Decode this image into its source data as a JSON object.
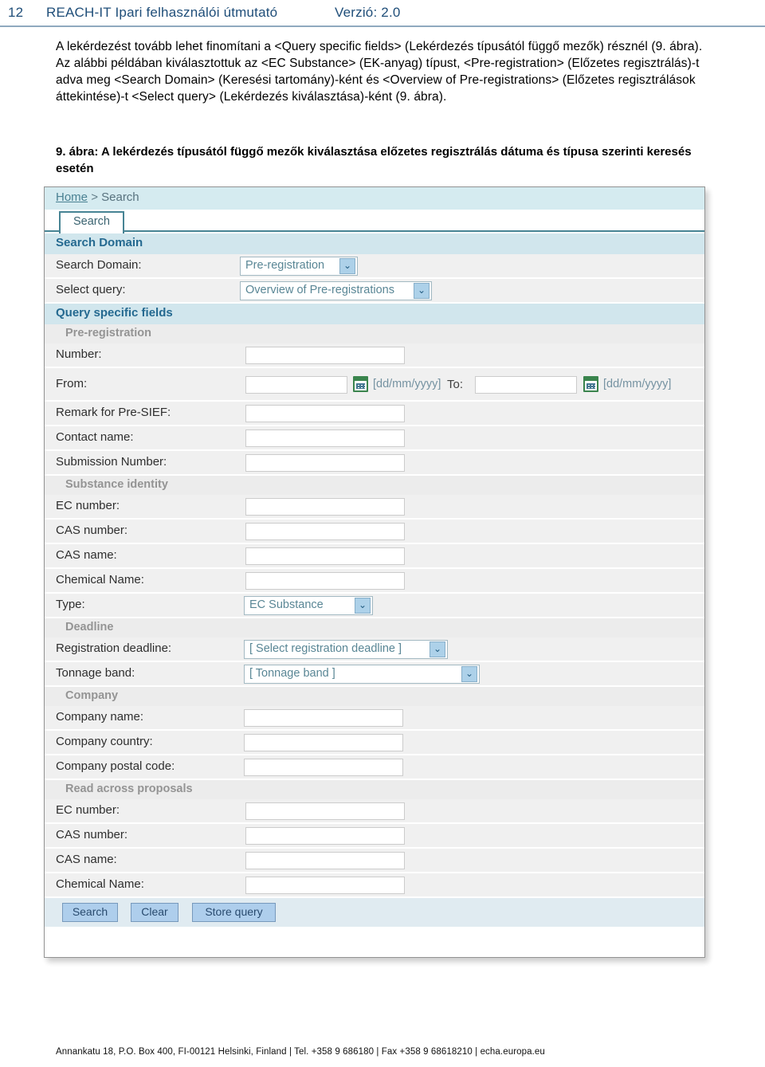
{
  "header": {
    "page_number": "12",
    "title": "REACH-IT Ipari felhasználói útmutató",
    "version": "Verzió: 2.0"
  },
  "body": {
    "paragraph": "A lekérdezést tovább lehet finomítani a <Query specific fields> (Lekérdezés típusától függő mezők) résznél (9. ábra). Az alábbi példában kiválasztottuk az <EC Substance> (EK-anyag) típust, <Pre-registration> (Előzetes regisztrálás)-t adva meg <Search Domain> (Keresési tartomány)-ként és <Overview of Pre-registrations> (Előzetes regisztrálások áttekintése)-t <Select query> (Lekérdezés kiválasztása)-ként (9. ábra).",
    "figure_caption": "9. ábra: A lekérdezés típusától függő mezők kiválasztása előzetes regisztrálás dátuma és típusa szerinti keresés esetén"
  },
  "screenshot": {
    "breadcrumb": {
      "home": "Home",
      "separator": ">",
      "current": "Search"
    },
    "tab": {
      "label": "Search"
    },
    "search_domain_band": "Search Domain",
    "search_domain_row": {
      "label": "Search Domain:",
      "value": "Pre-registration"
    },
    "select_query_row": {
      "label": "Select query:",
      "value": "Overview of Pre-registrations"
    },
    "query_specific_band": "Query specific fields",
    "groups": {
      "pre_registration": "Pre-registration",
      "substance_identity": "Substance identity",
      "deadline": "Deadline",
      "company": "Company",
      "read_across": "Read across proposals"
    },
    "fields": {
      "number": "Number:",
      "from": "From:",
      "to": "To:",
      "date_hint": "[dd/mm/yyyy]",
      "remark_presief": "Remark for Pre-SIEF:",
      "contact_name": "Contact name:",
      "submission_number": "Submission Number:",
      "ec_number": "EC number:",
      "cas_number": "CAS number:",
      "cas_name": "CAS name:",
      "chemical_name": "Chemical Name:",
      "type": "Type:",
      "registration_deadline": "Registration deadline:",
      "tonnage_band": "Tonnage band:",
      "company_name": "Company name:",
      "company_country": "Company country:",
      "company_postal_code": "Company postal code:"
    },
    "values": {
      "type": "EC Substance",
      "registration_deadline": "[ Select registration deadline ]",
      "tonnage_band": "[ Tonnage band ]"
    },
    "buttons": {
      "search": "Search",
      "clear": "Clear",
      "store_query": "Store query"
    },
    "dropdown_arrow": "⌄",
    "colors": {
      "breadcrumb_bg": "#d3eaf0",
      "band_bg": "#cfe5ec",
      "band_text": "#17608a",
      "row_bg": "#f0f0f0",
      "subband_text": "#8e8e8e",
      "button_bg": "#a9cbeb",
      "tab_border": "#3c7d8e",
      "calendar_green": "#2e7d42"
    }
  },
  "footer": {
    "text": "Annankatu 18, P.O. Box 400, FI-00121 Helsinki, Finland | Tel. +358 9 686180 | Fax +358 9 68618210 | echa.europa.eu"
  }
}
